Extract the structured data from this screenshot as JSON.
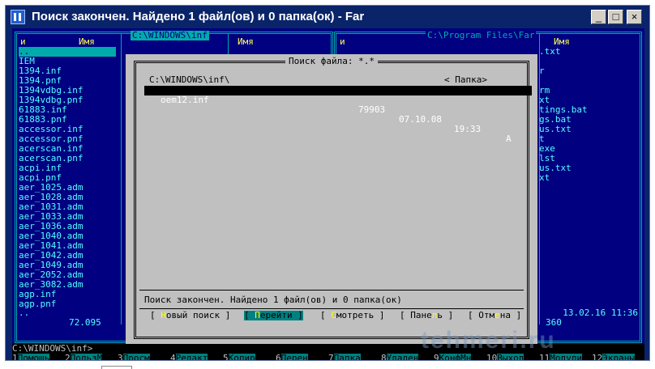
{
  "window": {
    "title": "Поиск закончен. Найдено 1 файл(ов) и 0 папка(ок) - Far",
    "controls": [
      "_",
      "□",
      "×"
    ]
  },
  "left_panel": {
    "path": "C:\\WINDOWS\\inf",
    "col1": "и",
    "col2": "Имя",
    "col3": "Имя",
    "files": [
      "..",
      "IEM",
      "1394.inf",
      "1394.pnf",
      "1394vdbg.inf",
      "1394vdbg.pnf",
      "61883.inf",
      "61883.pnf",
      "accessor.inf",
      "accessor.pnf",
      "acerscan.inf",
      "acerscan.pnf",
      "acpi.inf",
      "acpi.pnf",
      "aer_1025.adm",
      "aer_1028.adm",
      "aer_1031.adm",
      "aer_1033.adm",
      "aer_1036.adm",
      "aer_1040.adm",
      "aer_1041.adm",
      "aer_1042.adm",
      "aer_1049.adm",
      "aer_2052.adm",
      "aer_3082.adm",
      "agp.inf",
      "agp.pnf"
    ],
    "bottom_name": "..",
    "total": "72.095"
  },
  "right_panel": {
    "path": "C:\\Program Files\\Far",
    "col1": "и",
    "col2": "Имя",
    "files": [
      ".txt",
      "",
      "r",
      "",
      "rm",
      "xt",
      "tings.bat",
      "gs.bat",
      "us.txt",
      "t",
      "exe",
      "lst",
      "us.txt",
      "xt"
    ],
    "date": "13.02.16 11:36",
    "total": "360"
  },
  "dialog": {
    "title": "Поиск файла: *.*",
    "path": "C:\\WINDOWS\\inf\\",
    "folder": "< Папка>",
    "result": {
      "name": "oem12.inf",
      "size": "79903",
      "date": "07.10.08",
      "time": "19:33",
      "attr": "A"
    },
    "status": "Поиск закончен. Найдено 1 файл(ов) и 0 папка(ок)",
    "buttons": {
      "new_search": {
        "pre": "[ ",
        "hk": "Н",
        "rest": "овый поиск ]"
      },
      "goto": {
        "pre": "[ ",
        "hk": "П",
        "rest": "ерейти ]"
      },
      "view": {
        "pre": "[ ",
        "hk": "С",
        "rest": "мотреть ]"
      },
      "panel": {
        "pre": "[ Пане",
        "hk": "л",
        "rest": "ь ]"
      },
      "cancel": {
        "pre": "[ Отм",
        "hk": "е",
        "rest": "на ]"
      }
    }
  },
  "command_line": "C:\\WINDOWS\\inf>",
  "keybar": [
    {
      "num": "1",
      "label": "Помощь"
    },
    {
      "num": "2",
      "label": "ПользМ"
    },
    {
      "num": "3",
      "label": "Просм"
    },
    {
      "num": "4",
      "label": "Редакт"
    },
    {
      "num": "5",
      "label": "Копир"
    },
    {
      "num": "6",
      "label": "Перен"
    },
    {
      "num": "7",
      "label": "Папка"
    },
    {
      "num": "8",
      "label": "Удален"
    },
    {
      "num": "9",
      "label": "КонфМн"
    },
    {
      "num": "10",
      "label": "Выход"
    },
    {
      "num": "11",
      "label": "Модули"
    },
    {
      "num": "12",
      "label": "Экраны"
    }
  ],
  "watermark": "tehmeri.ru"
}
